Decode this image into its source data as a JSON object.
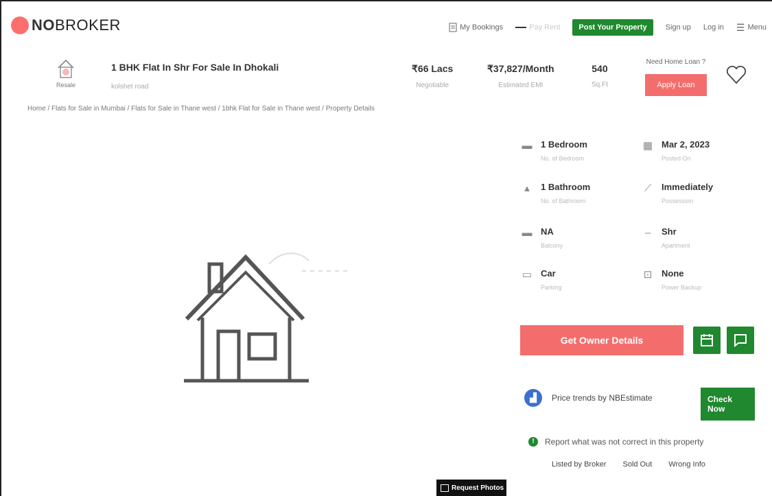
{
  "header": {
    "logo_part1": "NO",
    "logo_part2": "BROKER",
    "my_bookings": "My Bookings",
    "pay_rent": "Pay Rent",
    "post_property": "Post Your Property",
    "sign_up": "Sign up",
    "log_in": "Log in",
    "menu": "Menu"
  },
  "listing": {
    "badge": "Resale",
    "title": "1 BHK Flat In Shr For Sale In Dhokali",
    "subtitle": "kolshet road",
    "price": "₹66 Lacs",
    "price_note": "Negotiable",
    "emi": "₹37,827/Month",
    "emi_note": "Estimated EMI",
    "area": "540",
    "area_unit": "Sq.Ft",
    "loan_question": "Need Home Loan ?",
    "loan_button": "Apply Loan"
  },
  "breadcrumb": "Home / Flats for Sale in Mumbai / Flats for Sale in Thane west / 1bhk Flat for Sale in Thane west / Property Details",
  "details": [
    {
      "value": "1 Bedroom",
      "label": "No. of Bedroom",
      "icon": "bed-icon"
    },
    {
      "value": "Mar 2, 2023",
      "label": "Posted On",
      "icon": "calendar-icon"
    },
    {
      "value": "1 Bathroom",
      "label": "No. of Bathroom",
      "icon": "bath-icon"
    },
    {
      "value": "Immediately",
      "label": "Possession",
      "icon": "key-icon"
    },
    {
      "value": "NA",
      "label": "Balcony",
      "icon": "balcony-icon"
    },
    {
      "value": "Shr",
      "label": "Apartment",
      "icon": "building-icon"
    },
    {
      "value": "Car",
      "label": "Parking",
      "icon": "car-icon"
    },
    {
      "value": "None",
      "label": "Power Backup",
      "icon": "power-icon"
    }
  ],
  "actions": {
    "owner_details": "Get Owner Details",
    "price_trends": "Price trends by NBEstimate",
    "check_now": "Check Now",
    "report": "Report what was not correct in this property",
    "listed_by_broker": "Listed by Broker",
    "sold_out": "Sold Out",
    "wrong_info": "Wrong Info",
    "request_photos": "Request Photos"
  },
  "colors": {
    "brand": "#fd6f6f",
    "green": "#20882f",
    "coral": "#f46d6d"
  }
}
